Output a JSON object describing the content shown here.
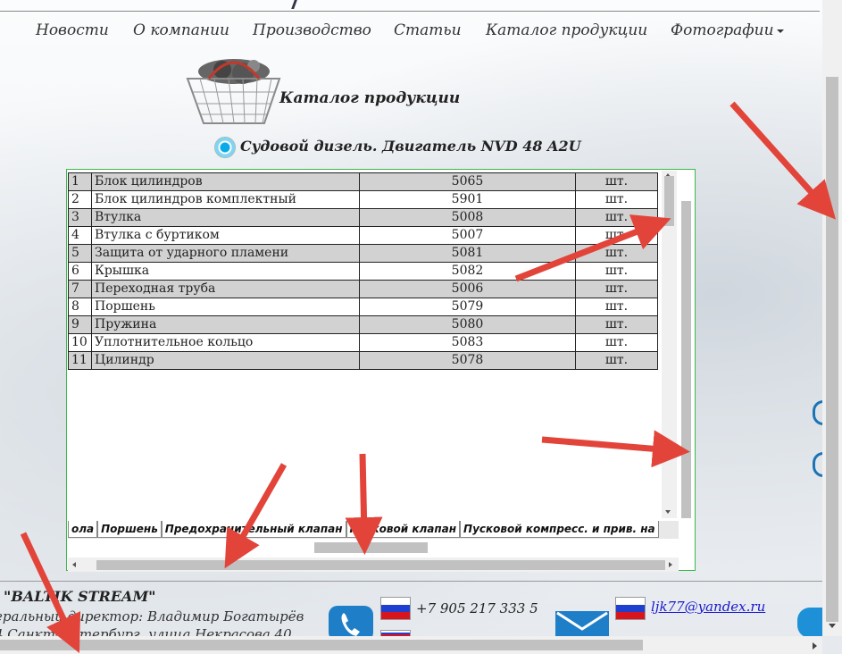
{
  "nav": {
    "items": [
      {
        "label": "Новости"
      },
      {
        "label": "О компании"
      },
      {
        "label": "Производство"
      },
      {
        "label": "Статьи"
      },
      {
        "label": "Каталог продукции"
      },
      {
        "label": "Фотографии"
      }
    ]
  },
  "catalog": {
    "title": "Каталог продукции",
    "subtitle": "Судовой дизель. Двигатель NVD 48 A2U"
  },
  "table": {
    "rows": [
      {
        "num": "1",
        "name": "Блок цилиндров",
        "code": "5065",
        "unit": "шт."
      },
      {
        "num": "2",
        "name": "Блок цилиндров комплектный",
        "code": "5901",
        "unit": "шт."
      },
      {
        "num": "3",
        "name": "Втулка",
        "code": "5008",
        "unit": "шт."
      },
      {
        "num": "4",
        "name": "Втулка с буртиком",
        "code": "5007",
        "unit": "шт."
      },
      {
        "num": "5",
        "name": "Защита от ударного пламени",
        "code": "5081",
        "unit": "шт."
      },
      {
        "num": "6",
        "name": "Крышка",
        "code": "5082",
        "unit": "шт."
      },
      {
        "num": "7",
        "name": "Переходная труба",
        "code": "5006",
        "unit": "шт."
      },
      {
        "num": "8",
        "name": "Поршень",
        "code": "5079",
        "unit": "шт."
      },
      {
        "num": "9",
        "name": "Пружина",
        "code": "5080",
        "unit": "шт."
      },
      {
        "num": "10",
        "name": "Уплотнительное кольцо",
        "code": "5083",
        "unit": "шт."
      },
      {
        "num": "11",
        "name": "Цилиндр",
        "code": "5078",
        "unit": "шт."
      }
    ]
  },
  "sheet_tabs": [
    "ола",
    "Поршень",
    "Предохранительный клапан",
    "Пусковой клапан",
    "Пусковой компресс. и прив. на"
  ],
  "footer": {
    "company": "\"BALTIK STREAM\"",
    "director": "еральный директор: Владимир Богатырёв",
    "address": "4 Санкт-Петербург, улица Некрасова 40",
    "phone": "+7 905 217 333 5",
    "email": "ljk77@yandex.ru"
  },
  "colors": {
    "frame_border": "#3cb94a",
    "annotation_arrow": "#e2443a",
    "link": "#1a1acc",
    "icon_blue": "#1e7fc8"
  },
  "icons": [
    "basket-icon",
    "radio-icon",
    "phone-icon",
    "flag-ru-icon",
    "mail-icon",
    "skype-icon"
  ]
}
